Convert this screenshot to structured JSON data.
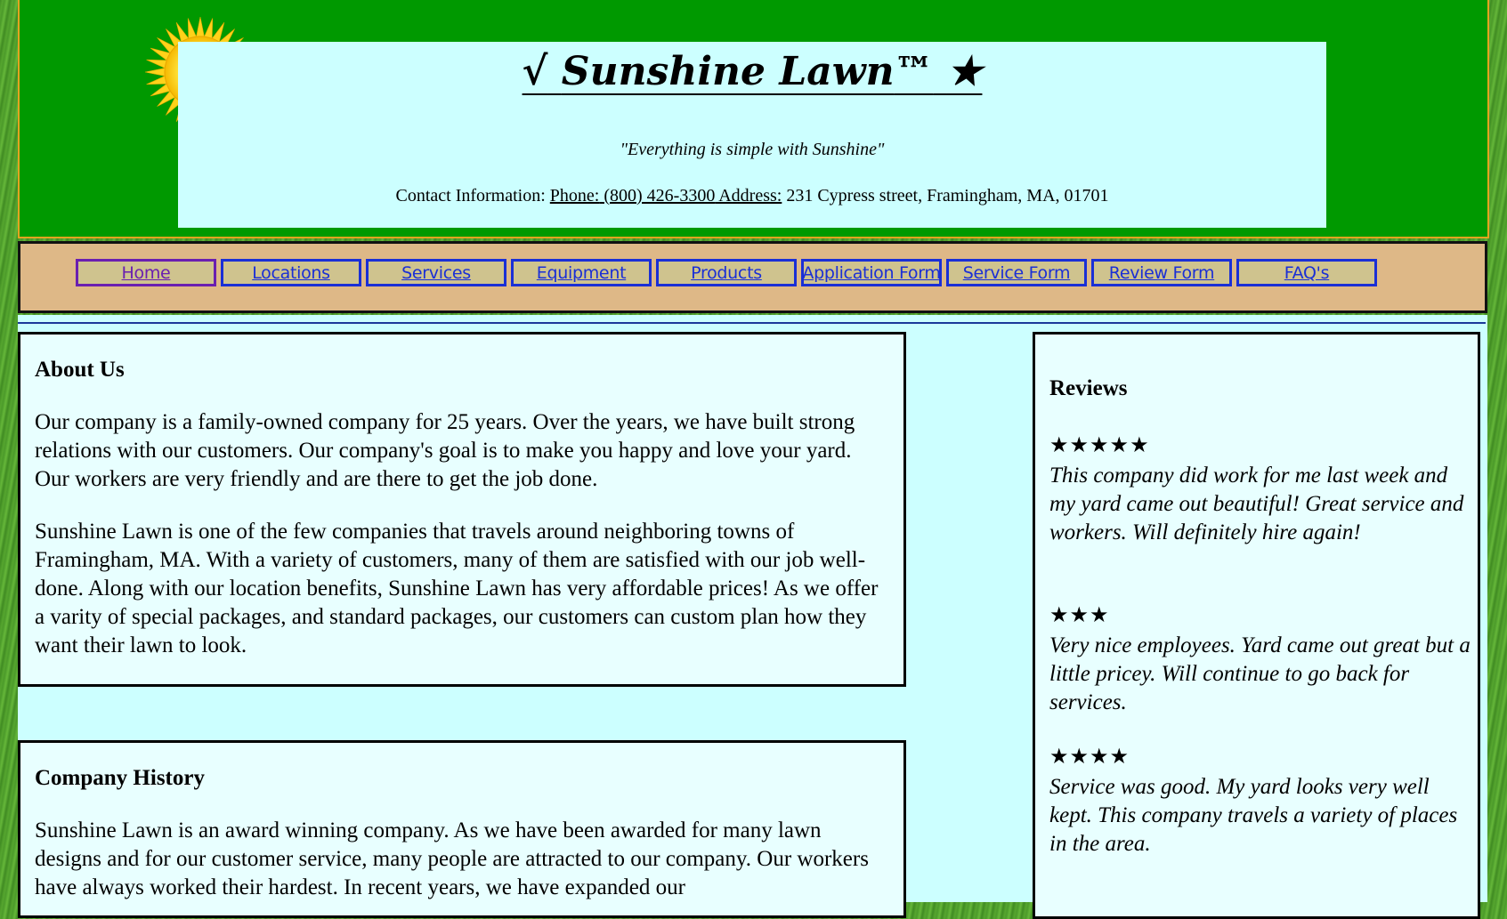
{
  "header": {
    "title_check": "√",
    "title": "Sunshine Lawn",
    "title_tm": "™",
    "title_star": "★",
    "tagline": "\"Everything is simple with Sunshine\"",
    "contact_prefix": "Contact Information: ",
    "phone_label": "Phone:",
    "phone_value": " (800) 426-3300",
    "address_label": " Address:",
    "address_value": " 231 Cypress street, Framingham, MA, 01701"
  },
  "nav": {
    "items": [
      {
        "label": "Home"
      },
      {
        "label": "Locations"
      },
      {
        "label": "Services"
      },
      {
        "label": "Equipment"
      },
      {
        "label": "Products"
      },
      {
        "label": "Application Form"
      },
      {
        "label": "Service Form"
      },
      {
        "label": "Review Form"
      },
      {
        "label": "FAQ's"
      }
    ]
  },
  "about": {
    "heading": "About Us",
    "p1": "Our company is a family-owned company for 25 years. Over the years, we have built strong relations with our customers. Our company's goal is to make you happy and love your yard. Our workers are very friendly and are there to get the job done.",
    "p2": "Sunshine Lawn is one of the few companies that travels around neighboring towns of Framingham, MA. With a variety of customers, many of them are satisfied with our job well-done. Along with our location benefits, Sunshine Lawn has very affordable prices! As we offer a varity of special packages, and standard packages, our customers can custom plan how they want their lawn to look."
  },
  "history": {
    "heading": "Company History",
    "p1": "Sunshine Lawn is an award winning company. As we have been awarded for many lawn designs and for our customer service, many people are attracted to our company. Our workers have always worked their hardest. In recent years, we have expanded our"
  },
  "reviews": {
    "heading": "Reviews",
    "items": [
      {
        "stars": "★★★★★",
        "text": "This company did work for me last week and my yard came out beautiful! Great service and workers. Will definitely hire again!"
      },
      {
        "stars": "★★★",
        "text": "Very nice employees. Yard came out great but a little pricey. Will continue to go back for services."
      },
      {
        "stars": "★★★★",
        "text": "Service was good. My yard looks very well kept. This company travels a variety of places in the area."
      }
    ]
  },
  "colors": {
    "header_bg": "#009900",
    "title_box_bg": "#ccffff",
    "nav_bg": "#deb887",
    "nav_button_bg": "#cfc38e",
    "nav_link": "#1a2fd6",
    "nav_visited": "#6a1fb0"
  },
  "icons": {
    "sun": "sun-icon"
  }
}
